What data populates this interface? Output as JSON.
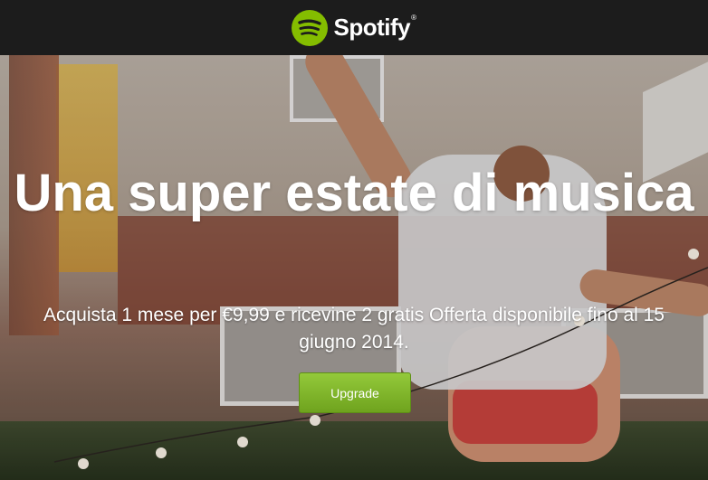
{
  "brand": {
    "name": "Spotify",
    "trademark": "®",
    "accent_color": "#84bd00"
  },
  "hero": {
    "headline": "Una super estate di musica",
    "subline": "Acquista 1 mese per €9,99 e ricevine 2 gratis Offerta disponibile fino al 15 giugno 2014.",
    "cta_label": "Upgrade",
    "cta_color": "#7fb42a"
  },
  "icons": {
    "logo": "spotify-logo-icon"
  }
}
